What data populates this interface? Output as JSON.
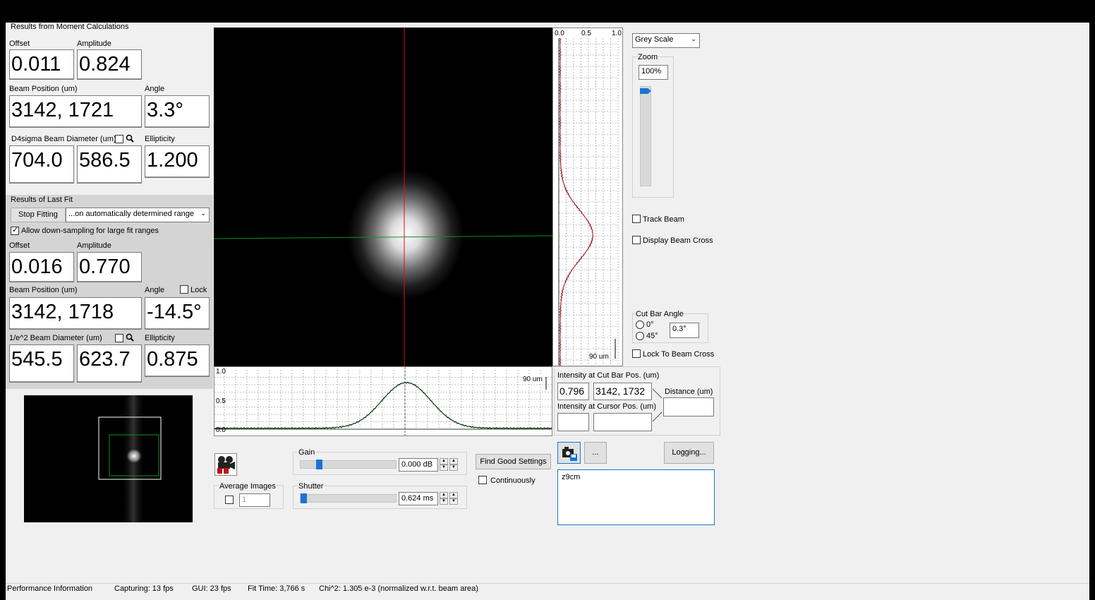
{
  "moment": {
    "section_title": "Results from Moment Calculations",
    "offset_label": "Offset",
    "offset": "0.011",
    "amplitude_label": "Amplitude",
    "amplitude": "0.824",
    "position_label": "Beam Position (um)",
    "position": "3142, 1721",
    "angle_label": "Angle",
    "angle": "3.3°",
    "diameter_label": "D4sigma Beam Diameter (um)",
    "diameter_x": "704.0",
    "diameter_y": "586.5",
    "ellipticity_label": "Ellipticity",
    "ellipticity": "1.200"
  },
  "fit": {
    "section_title": "Results of Last Fit",
    "stop_button": "Stop Fitting",
    "range_select": "...on automatically determined range",
    "downsample_label": "Allow down-sampling for large fit ranges",
    "offset_label": "Offset",
    "offset": "0.016",
    "amplitude_label": "Amplitude",
    "amplitude": "0.770",
    "position_label": "Beam Position (um)",
    "position": "3142, 1718",
    "angle_label": "Angle",
    "lock_label": "Lock",
    "angle": "-14.5°",
    "diameter_label": "1/e^2 Beam Diameter (um)",
    "diameter_x": "545.5",
    "diameter_y": "623.7",
    "ellipticity_label": "Ellipticity",
    "ellipticity": "0.875"
  },
  "vertical_profile": {
    "tick_0": "0.0",
    "tick_05": "0.5",
    "tick_1": "1.0",
    "scale": "90 um"
  },
  "horizontal_profile": {
    "tick_1": "1.0",
    "tick_05": "0.5",
    "tick_0": "0.0",
    "scale": "90 um"
  },
  "display": {
    "colormap": "Grey Scale",
    "zoom_label": "Zoom",
    "zoom": "100%",
    "track_beam": "Track Beam",
    "display_cross": "Display Beam Cross",
    "cutbar_label": "Cut Bar Angle",
    "opt_0": "0°",
    "opt_45": "45°",
    "cutbar_angle": "0.3°",
    "lock_cross": "Lock To Beam Cross"
  },
  "intensity": {
    "cutbar_label": "Intensity at Cut Bar Pos. (um)",
    "cutbar_value": "0.796",
    "cutbar_pos": "3142, 1732",
    "distance_label": "Distance (um)",
    "cursor_label": "Intensity at Cursor Pos. (um)"
  },
  "camera": {
    "avg_label": "Average Images",
    "avg_value": "1",
    "gain_label": "Gain",
    "gain_value": "0.000 dB",
    "shutter_label": "Shutter",
    "shutter_value": "0.624 ms",
    "find_button": "Find Good Settings",
    "continuously": "Continuously",
    "more_button": "...",
    "logging_button": "Logging...",
    "notes": "z9cm"
  },
  "status": {
    "perf": "Performance Information",
    "capturing": "Capturing: 13 fps",
    "gui": "GUI: 23 fps",
    "fit_time": "Fit Time: 3,766 s",
    "chi": "Chi^2:  1.305 e-3  (normalized w.r.t. beam area)"
  },
  "colors": {
    "cut_vertical": "#e01010",
    "cut_horizontal": "#109020",
    "fit_curve": "#c01010",
    "accent": "#1a73d6"
  },
  "icons": [
    "camera-record-icon",
    "snapshot-icon",
    "search-icon",
    "chevron-down-icon"
  ]
}
